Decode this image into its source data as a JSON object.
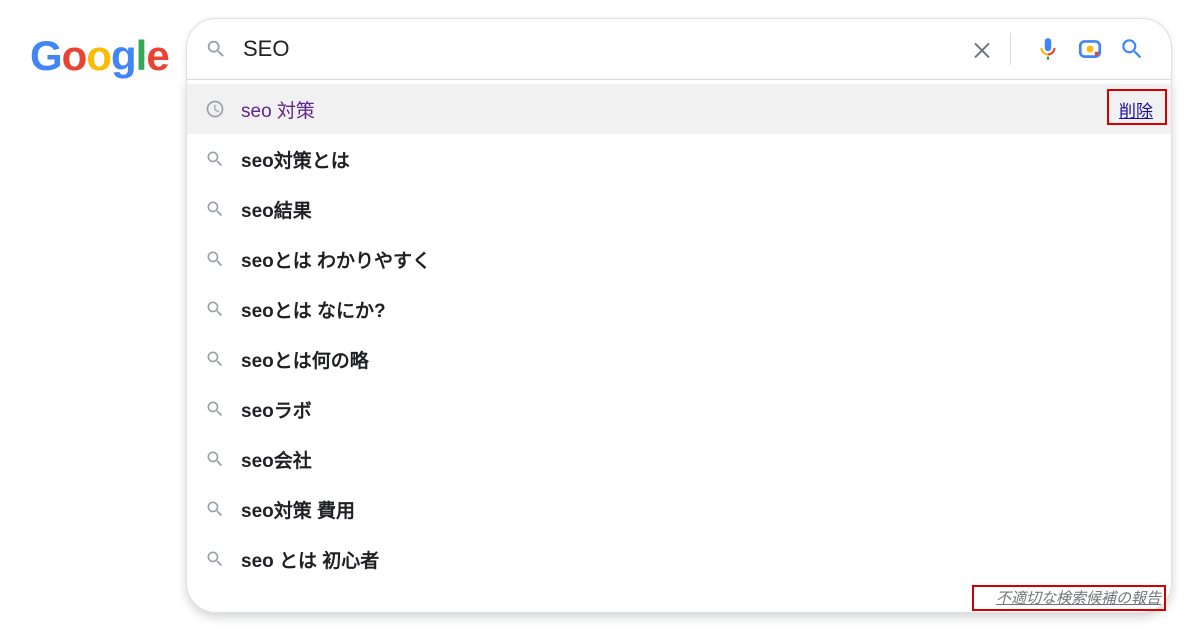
{
  "logo": {
    "text": "Google",
    "letters": [
      "G",
      "o",
      "o",
      "g",
      "l",
      "e"
    ],
    "colors": [
      "#4285F4",
      "#EA4335",
      "#FBBC05",
      "#4285F4",
      "#34A853",
      "#EA4335"
    ]
  },
  "search": {
    "value": "SEO",
    "icon_search": "magnifier-icon",
    "icon_clear": "clear-icon",
    "icon_mic": "microphone-icon",
    "icon_lens": "lens-icon",
    "icon_submit": "search-icon"
  },
  "suggestions": [
    {
      "text": "seo 対策",
      "type": "history",
      "highlighted": true,
      "delete_label": "削除"
    },
    {
      "text": "seo対策とは",
      "type": "search"
    },
    {
      "text": "seo結果",
      "type": "search"
    },
    {
      "text": "seoとは わかりやすく",
      "type": "search"
    },
    {
      "text": "seoとは なにか?",
      "type": "search"
    },
    {
      "text": "seoとは何の略",
      "type": "search"
    },
    {
      "text": "seoラボ",
      "type": "search"
    },
    {
      "text": "seo会社",
      "type": "search"
    },
    {
      "text": "seo対策 費用",
      "type": "search"
    },
    {
      "text": "seo とは 初心者",
      "type": "search"
    }
  ],
  "dropdown_footer": "不適切な検索候補の報告"
}
